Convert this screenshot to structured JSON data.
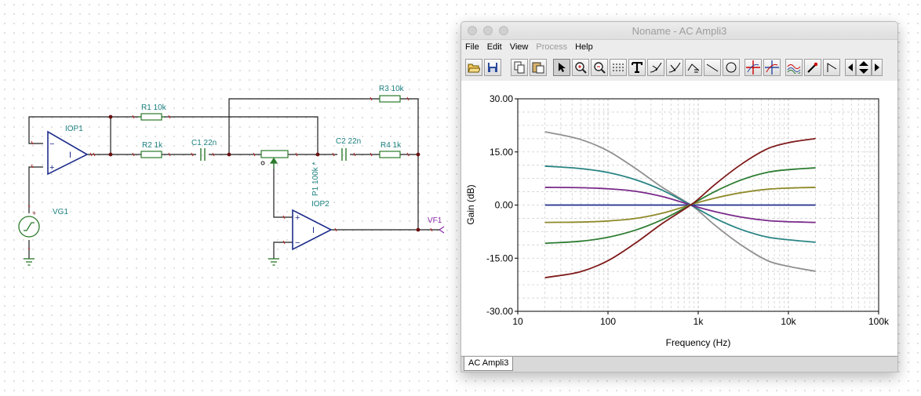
{
  "schematic": {
    "labels": {
      "r1": "R1 10k",
      "r2": "R2 1k",
      "r3": "R3 10k",
      "r4": "R4 1k",
      "c1": "C1 22n",
      "c2": "C2 22n",
      "iop1": "IOP1",
      "iop2": "IOP2",
      "p1": "P1 100k *",
      "vg1": "VG1",
      "vf1": "VF1",
      "amp1_glyph": "I",
      "amp2_glyph": "I",
      "minus": "−",
      "plus": "+"
    },
    "colors": {
      "wire": "#1e1e1e",
      "component": "#2a7a2a",
      "label": "#1c7f7f",
      "opamp": "#1f2e8c",
      "probe": "#8a2ba8"
    }
  },
  "window": {
    "title": "Noname - AC Ampli3",
    "menu": [
      {
        "label": "File",
        "enabled": true
      },
      {
        "label": "Edit",
        "enabled": true
      },
      {
        "label": "View",
        "enabled": true
      },
      {
        "label": "Process",
        "enabled": false
      },
      {
        "label": "Help",
        "enabled": true
      }
    ],
    "toolbar_icons": [
      "open-icon",
      "save-icon",
      "copy-icon",
      "paste-icon",
      "pointer-icon",
      "zoom-in-icon",
      "zoom-out-icon",
      "grid-icon",
      "text-icon",
      "cursor-a-icon",
      "cursor-b-icon",
      "curve-icon",
      "line-icon",
      "ellipse-icon",
      "marker-a-icon",
      "marker-b-icon",
      "waveform-icon",
      "probe-icon",
      "slope-icon",
      "arrow-left-icon",
      "arrow-updown-icon",
      "arrow-right-icon"
    ],
    "tab_label": "AC Ampli3"
  },
  "chart_data": {
    "type": "line",
    "xlabel": "Frequency (Hz)",
    "ylabel": "Gain (dB)",
    "x_scale": "log",
    "xlim": [
      10,
      100000
    ],
    "ylim": [
      -30,
      30
    ],
    "x_ticks": [
      10,
      100,
      1000,
      10000,
      100000
    ],
    "x_tick_labels": [
      "10",
      "100",
      "1k",
      "10k",
      "100k"
    ],
    "y_ticks": [
      -30,
      -15,
      0,
      15,
      30
    ],
    "y_tick_labels": [
      "-30.00",
      "-15.00",
      "0.00",
      "15.00",
      "30.00"
    ],
    "grid": true,
    "x": [
      20,
      50,
      100,
      200,
      400,
      700,
      900,
      1500,
      3000,
      6000,
      10000,
      20000
    ],
    "series": [
      {
        "color": "#909090",
        "values": [
          20.7,
          18.5,
          15.3,
          10.4,
          5.0,
          1.2,
          -0.6,
          -5.5,
          -11.3,
          -15.8,
          -17.3,
          -18.7
        ]
      },
      {
        "color": "#2a8484",
        "values": [
          11.0,
          10.3,
          9.2,
          7.2,
          4.2,
          1.0,
          -0.5,
          -3.6,
          -6.9,
          -9.1,
          -9.8,
          -10.5
        ]
      },
      {
        "color": "#7a2a8a",
        "values": [
          5.0,
          4.9,
          4.6,
          3.9,
          2.4,
          0.6,
          -0.3,
          -1.8,
          -3.4,
          -4.4,
          -4.7,
          -4.9
        ]
      },
      {
        "color": "#1f2e8c",
        "values": [
          0,
          0,
          0,
          0,
          0,
          0,
          0,
          0,
          0,
          0,
          0,
          0
        ]
      },
      {
        "color": "#8f8a2a",
        "values": [
          -4.9,
          -4.8,
          -4.5,
          -3.8,
          -2.3,
          -0.5,
          0.4,
          1.9,
          3.5,
          4.5,
          4.8,
          5.0
        ]
      },
      {
        "color": "#2e7d32",
        "values": [
          -10.8,
          -10.2,
          -9.1,
          -7.1,
          -4.1,
          -0.9,
          0.6,
          3.7,
          7.1,
          9.3,
          10.0,
          10.5
        ]
      },
      {
        "color": "#7f1a1a",
        "values": [
          -20.5,
          -18.8,
          -15.7,
          -10.8,
          -5.2,
          -1.2,
          0.7,
          5.6,
          11.5,
          16.0,
          17.6,
          18.8
        ]
      }
    ]
  }
}
